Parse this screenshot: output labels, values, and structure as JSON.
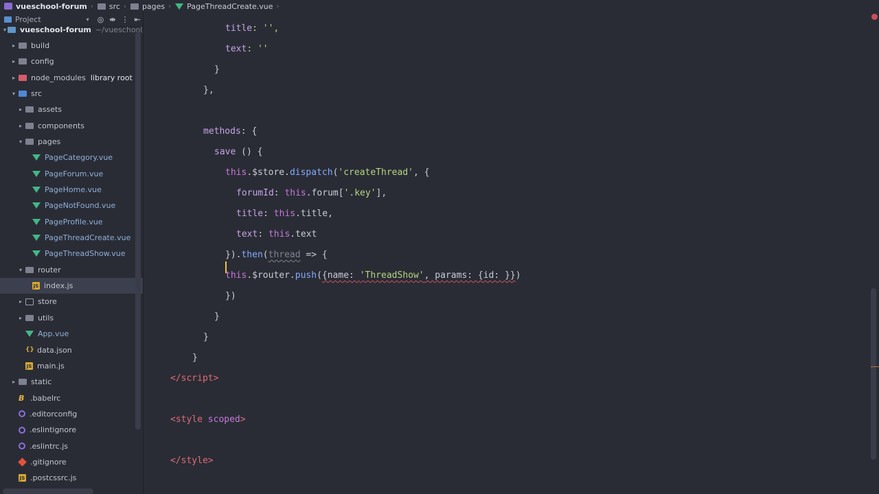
{
  "breadcrumb": {
    "project": "vueschool-forum",
    "folder1": "src",
    "folder2": "pages",
    "file": "PageThreadCreate.vue"
  },
  "project_panel": {
    "title": "Project",
    "dropdown_glyph": "▾",
    "tools": [
      "◎",
      "⇼",
      "⋮",
      "⇤"
    ]
  },
  "tree": [
    {
      "label": "vueschool-forum",
      "note": "~/vueschool/v",
      "icon": "project-folder-icon",
      "expanded": true
    },
    {
      "label": "build",
      "icon": "folder-icon",
      "expanded": false
    },
    {
      "label": "config",
      "icon": "folder-icon",
      "expanded": false
    },
    {
      "label": "node_modules",
      "note": "library root",
      "icon": "folder-red-icon",
      "expanded": false
    },
    {
      "label": "src",
      "icon": "folder-blue-icon",
      "expanded": true
    },
    {
      "label": "assets",
      "icon": "folder-icon",
      "expanded": false
    },
    {
      "label": "components",
      "icon": "folder-icon",
      "expanded": false
    },
    {
      "label": "pages",
      "icon": "folder-icon",
      "expanded": true
    },
    {
      "label": "PageCategory.vue",
      "icon": "vue-icon"
    },
    {
      "label": "PageForum.vue",
      "icon": "vue-icon"
    },
    {
      "label": "PageHome.vue",
      "icon": "vue-icon"
    },
    {
      "label": "PageNotFound.vue",
      "icon": "vue-icon"
    },
    {
      "label": "PageProfile.vue",
      "icon": "vue-icon"
    },
    {
      "label": "PageThreadCreate.vue",
      "icon": "vue-icon"
    },
    {
      "label": "PageThreadShow.vue",
      "icon": "vue-icon"
    },
    {
      "label": "router",
      "icon": "folder-icon",
      "expanded": true
    },
    {
      "label": "index.js",
      "icon": "js-icon",
      "selected": true
    },
    {
      "label": "store",
      "icon": "folder-outline-icon",
      "expanded": false
    },
    {
      "label": "utils",
      "icon": "folder-icon",
      "expanded": false
    },
    {
      "label": "App.vue",
      "icon": "vue-icon"
    },
    {
      "label": "data.json",
      "icon": "json-icon"
    },
    {
      "label": "main.js",
      "icon": "js-icon"
    },
    {
      "label": "static",
      "icon": "folder-icon",
      "expanded": false
    },
    {
      "label": ".babelrc",
      "icon": "babel-icon"
    },
    {
      "label": ".editorconfig",
      "icon": "gear-icon"
    },
    {
      "label": ".eslintignore",
      "icon": "eslint-icon"
    },
    {
      "label": ".eslintrc.js",
      "icon": "eslint-icon"
    },
    {
      "label": ".gitignore",
      "icon": "git-icon"
    },
    {
      "label": ".postcssrc.js",
      "icon": "js-icon"
    }
  ],
  "icons": {
    "js": "JS",
    "json": "{}",
    "babel": "B"
  },
  "code_text": {
    "l1_key": "title",
    "l1_rest": ": '',",
    "l2_key": "text",
    "l2_rest": ": ''",
    "l3": "}",
    "l4": "},",
    "l6_key": "methods",
    "l6_rest": ": {",
    "l7_key": "save",
    "l7_rest": " () {",
    "l8_this": "this",
    "l8_mid": ".$store.",
    "l8_fn": "dispatch",
    "l8_open": "(",
    "l8_str": "'createThread'",
    "l8_end": ", {",
    "l9_key": "forumId",
    "l9_colon": ": ",
    "l9_this": "this",
    "l9_mid": ".forum[",
    "l9_str": "'.key'",
    "l9_end": "],",
    "l10_key": "title",
    "l10_colon": ": ",
    "l10_this": "this",
    "l10_end": ".title,",
    "l11_key": "text",
    "l11_colon": ": ",
    "l11_this": "this",
    "l11_end": ".text",
    "l12_open": "}).",
    "l12_fn": "then",
    "l12_paren": "(",
    "l12_param": "thread",
    "l12_end": " => {",
    "l13_this": "this",
    "l13_mid": ".$router.",
    "l13_fn": "push",
    "l13_open": "(",
    "l13_obj1": "{name: ",
    "l13_str": "'ThreadShow'",
    "l13_obj2": ", params: {id: }}",
    "l13_end": ")",
    "l14": "})",
    "l15": "}",
    "l16": "}",
    "l17": "}",
    "l18_open": "</",
    "l18_tag": "script",
    "l18_close": ">",
    "l20_open": "<",
    "l20_tag": "style",
    "l20_attr": " scoped",
    "l20_close": ">",
    "l22_open": "</",
    "l22_tag": "style",
    "l22_close": ">"
  }
}
